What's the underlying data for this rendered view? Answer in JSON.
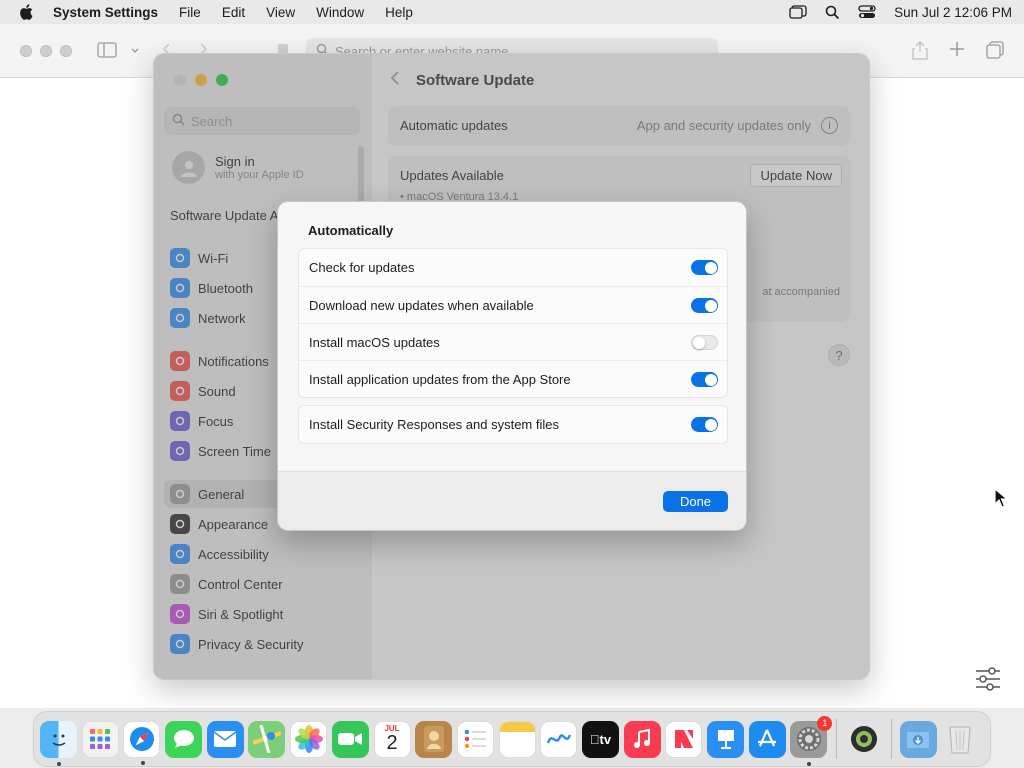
{
  "menubar": {
    "app_name": "System Settings",
    "menus": [
      "File",
      "Edit",
      "View",
      "Window",
      "Help"
    ],
    "datetime": "Sun Jul 2  12:06 PM"
  },
  "safari": {
    "address_placeholder": "Search or enter website name"
  },
  "sidebar": {
    "search_placeholder": "Search",
    "signin_title": "Sign in",
    "signin_subtitle": "with your Apple ID",
    "update_available": "Software Update Available",
    "items": [
      {
        "label": "Wi-Fi",
        "icon": "wifi-icon",
        "color": "#2f8cf0"
      },
      {
        "label": "Bluetooth",
        "icon": "bluetooth-icon",
        "color": "#2f8cf0"
      },
      {
        "label": "Network",
        "icon": "globe-icon",
        "color": "#2f8cf0"
      },
      {
        "label": "Notifications",
        "icon": "bell-icon",
        "color": "#f0504a"
      },
      {
        "label": "Sound",
        "icon": "speaker-icon",
        "color": "#f0504a"
      },
      {
        "label": "Focus",
        "icon": "moon-icon",
        "color": "#6a5bd6"
      },
      {
        "label": "Screen Time",
        "icon": "hourglass-icon",
        "color": "#6a5bd6"
      },
      {
        "label": "General",
        "icon": "gear-icon",
        "color": "#9a9a9a"
      },
      {
        "label": "Appearance",
        "icon": "appearance-icon",
        "color": "#2b2b2b"
      },
      {
        "label": "Accessibility",
        "icon": "accessibility-icon",
        "color": "#2f8cf0"
      },
      {
        "label": "Control Center",
        "icon": "control-center-icon",
        "color": "#9a9a9a"
      },
      {
        "label": "Siri & Spotlight",
        "icon": "siri-icon",
        "color": "#c24bd6"
      },
      {
        "label": "Privacy & Security",
        "icon": "hand-icon",
        "color": "#2f8cf0"
      }
    ]
  },
  "content": {
    "title": "Software Update",
    "automatic_updates_label": "Automatic updates",
    "automatic_updates_value": "App and security updates only",
    "updates_available_label": "Updates Available",
    "update_now_label": "Update Now",
    "update_item": "• macOS Ventura 13.4.1",
    "partial_text": "at accompanied",
    "help_label": "?"
  },
  "dialog": {
    "title": "Automatically",
    "options": [
      {
        "label": "Check for updates",
        "on": true
      },
      {
        "label": "Download new updates when available",
        "on": true
      },
      {
        "label": "Install macOS updates",
        "on": false
      },
      {
        "label": "Install application updates from the App Store",
        "on": true
      }
    ],
    "security_option": {
      "label": "Install Security Responses and system files",
      "on": true
    },
    "done_label": "Done"
  },
  "dock": {
    "calendar_month": "JUL",
    "calendar_day": "2",
    "tv_label": "tv",
    "settings_badge": "1"
  },
  "colors": {
    "accent": "#0a72e6",
    "traffic_red": "#ff5f57",
    "traffic_yellow": "#febc2e",
    "traffic_green": "#28c840"
  }
}
